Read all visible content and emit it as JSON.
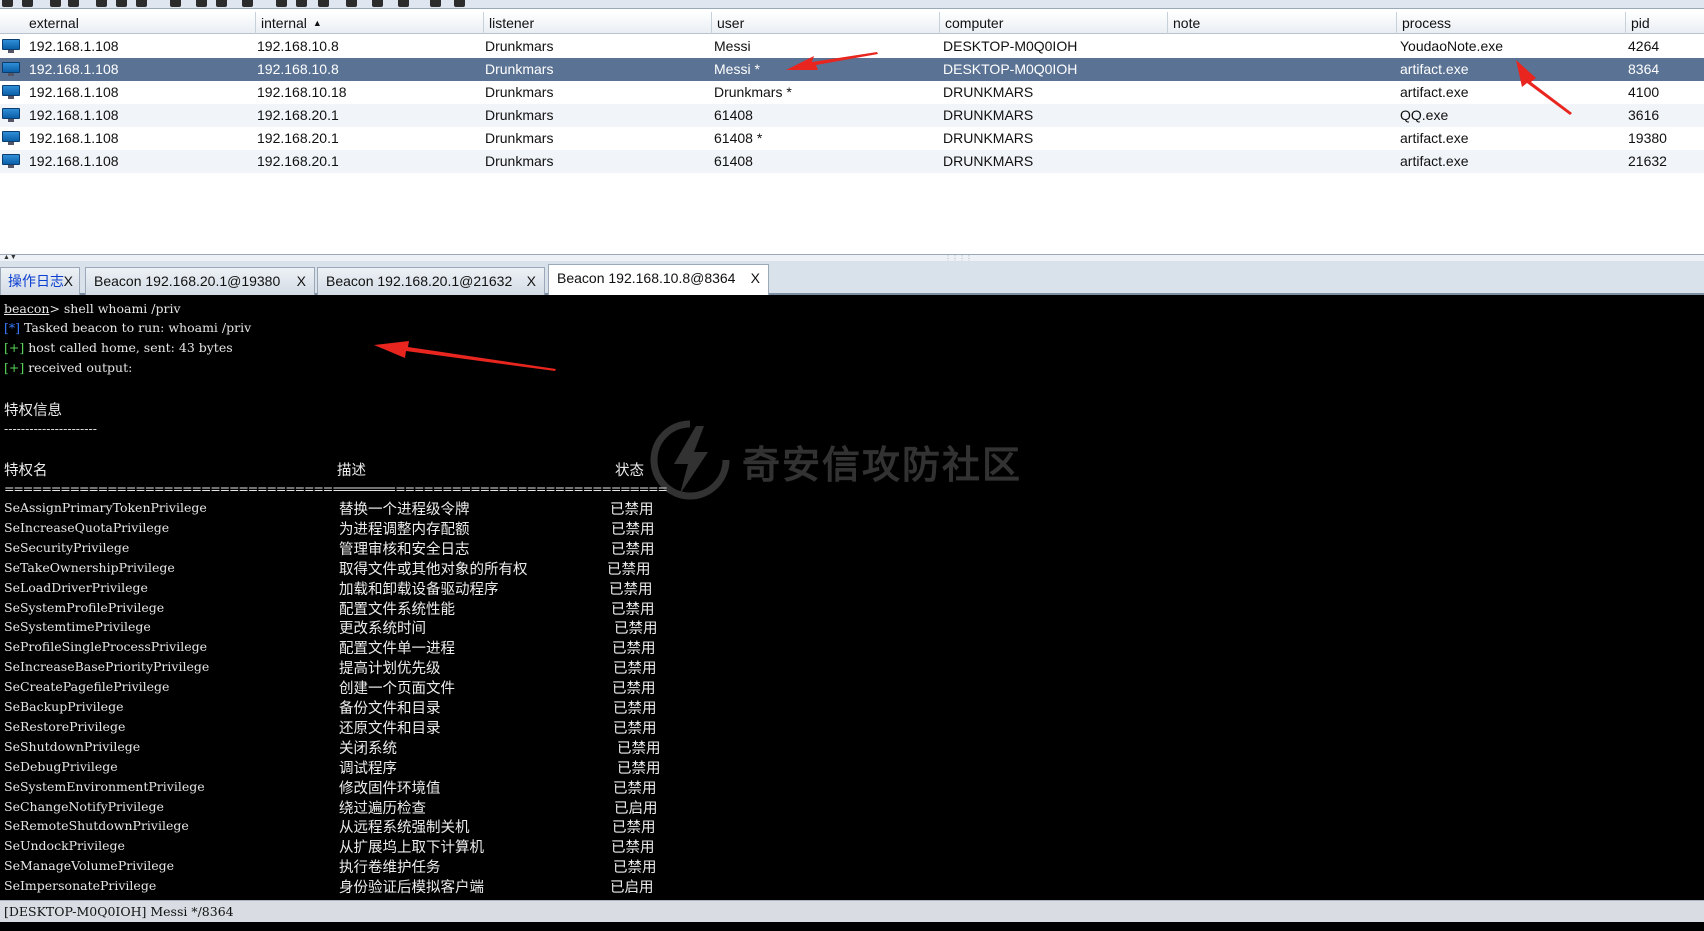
{
  "table": {
    "columns": [
      {
        "label": "external",
        "left": 0
      },
      {
        "label": "internal",
        "sorted": "ascending"
      },
      {
        "label": "listener"
      },
      {
        "label": "user"
      },
      {
        "label": "computer"
      },
      {
        "label": "note"
      },
      {
        "label": "process"
      },
      {
        "label": "pid"
      }
    ],
    "rows": [
      {
        "external": "192.168.1.108",
        "internal": "192.168.10.8",
        "listener": "Drunkmars",
        "user": "Messi",
        "computer": "DESKTOP-M0Q0IOH",
        "note": "",
        "process": "YoudaoNote.exe",
        "pid": "4264",
        "selected": false
      },
      {
        "external": "192.168.1.108",
        "internal": "192.168.10.8",
        "listener": "Drunkmars",
        "user": "Messi *",
        "computer": "DESKTOP-M0Q0IOH",
        "note": "",
        "process": "artifact.exe",
        "pid": "8364",
        "selected": true
      },
      {
        "external": "192.168.1.108",
        "internal": "192.168.10.18",
        "listener": "Drunkmars",
        "user": "Drunkmars *",
        "computer": "DRUNKMARS",
        "note": "",
        "process": "artifact.exe",
        "pid": "4100",
        "selected": false
      },
      {
        "external": "192.168.1.108",
        "internal": "192.168.20.1",
        "listener": "Drunkmars",
        "user": "61408",
        "computer": "DRUNKMARS",
        "note": "",
        "process": "QQ.exe",
        "pid": "3616",
        "selected": false
      },
      {
        "external": "192.168.1.108",
        "internal": "192.168.20.1",
        "listener": "Drunkmars",
        "user": "61408 *",
        "computer": "DRUNKMARS",
        "note": "",
        "process": "artifact.exe",
        "pid": "19380",
        "selected": false
      },
      {
        "external": "192.168.1.108",
        "internal": "192.168.20.1",
        "listener": "Drunkmars",
        "user": "61408",
        "computer": "DRUNKMARS",
        "note": "",
        "process": "artifact.exe",
        "pid": "21632",
        "selected": false
      }
    ]
  },
  "tabs": [
    {
      "label": "操作日志",
      "close": "X",
      "active": false,
      "blue": true
    },
    {
      "label": "Beacon 192.168.20.1@19380",
      "close": "X",
      "active": false
    },
    {
      "label": "Beacon 192.168.20.1@21632",
      "close": "X",
      "active": false
    },
    {
      "label": "Beacon 192.168.10.8@8364",
      "close": "X",
      "active": true
    }
  ],
  "console": {
    "prompt": "beacon",
    "command": "> shell whoami /priv",
    "line1_tag": "[*]",
    "line1": " Tasked beacon to run: whoami /priv",
    "line2_tag": "[+]",
    "line2": " host called home, sent: 43 bytes",
    "line3_tag": "[+]",
    "line3": " received output:",
    "heading": "特权信息",
    "heading_rule": "----------------------",
    "col_name": "特权名",
    "col_desc": "描述",
    "col_state": "状态",
    "rule_name": "=========================================",
    "rule_desc": "=================================",
    "rule_state": "=====",
    "privileges": [
      {
        "name": "SeAssignPrimaryTokenPrivilege",
        "desc": "替换一个进程级令牌",
        "state": "已禁用"
      },
      {
        "name": "SeIncreaseQuotaPrivilege",
        "desc": "为进程调整内存配额",
        "state": "已禁用"
      },
      {
        "name": "SeSecurityPrivilege",
        "desc": "管理审核和安全日志",
        "state": "已禁用"
      },
      {
        "name": "SeTakeOwnershipPrivilege",
        "desc": "取得文件或其他对象的所有权",
        "state": "已禁用"
      },
      {
        "name": "SeLoadDriverPrivilege",
        "desc": "加载和卸载设备驱动程序",
        "state": "已禁用"
      },
      {
        "name": "SeSystemProfilePrivilege",
        "desc": "配置文件系统性能",
        "state": "已禁用"
      },
      {
        "name": "SeSystemtimePrivilege",
        "desc": "更改系统时间",
        "state": "已禁用"
      },
      {
        "name": "SeProfileSingleProcessPrivilege",
        "desc": "配置文件单一进程",
        "state": "已禁用"
      },
      {
        "name": "SeIncreaseBasePriorityPrivilege",
        "desc": "提高计划优先级",
        "state": "已禁用"
      },
      {
        "name": "SeCreatePagefilePrivilege",
        "desc": "创建一个页面文件",
        "state": "已禁用"
      },
      {
        "name": "SeBackupPrivilege",
        "desc": "备份文件和目录",
        "state": "已禁用"
      },
      {
        "name": "SeRestorePrivilege",
        "desc": "还原文件和目录",
        "state": "已禁用"
      },
      {
        "name": "SeShutdownPrivilege",
        "desc": "关闭系统",
        "state": "已禁用"
      },
      {
        "name": "SeDebugPrivilege",
        "desc": "调试程序",
        "state": "已禁用"
      },
      {
        "name": "SeSystemEnvironmentPrivilege",
        "desc": "修改固件环境值",
        "state": "已禁用"
      },
      {
        "name": "SeChangeNotifyPrivilege",
        "desc": "绕过遍历检查",
        "state": "已启用"
      },
      {
        "name": "SeRemoteShutdownPrivilege",
        "desc": "从远程系统强制关机",
        "state": "已禁用"
      },
      {
        "name": "SeUndockPrivilege",
        "desc": "从扩展坞上取下计算机",
        "state": "已禁用"
      },
      {
        "name": "SeManageVolumePrivilege",
        "desc": "执行卷维护任务",
        "state": "已禁用"
      },
      {
        "name": "SeImpersonatePrivilege",
        "desc": "身份验证后模拟客户端",
        "state": "已启用"
      }
    ]
  },
  "watermark": {
    "text": "奇安信攻防社区"
  },
  "statusbar": {
    "text": "[DESKTOP-M0Q0IOH] Messi */8364"
  },
  "colors": {
    "selected_row": "#5a7293",
    "arrow": "#e8261f",
    "console_bg": "#000000",
    "tag_blue": "#3a7bff",
    "tag_green": "#57d357"
  }
}
